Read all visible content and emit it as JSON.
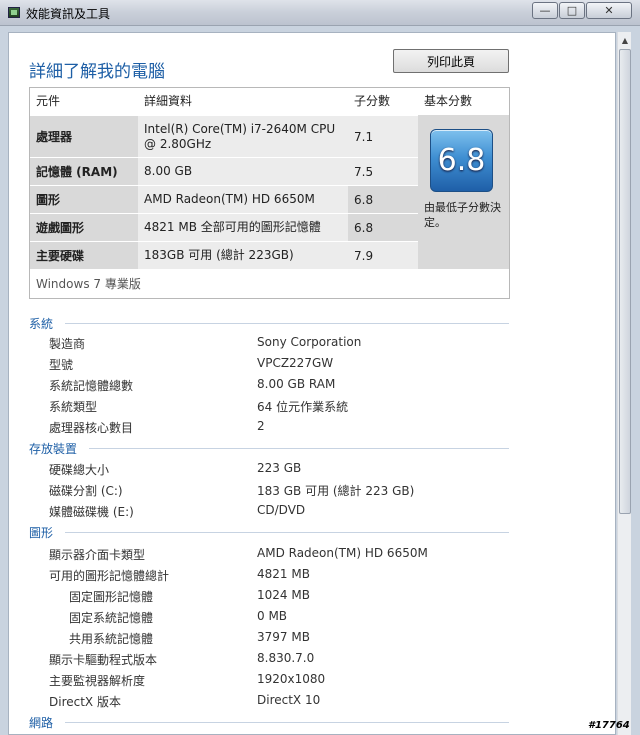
{
  "window": {
    "title": "效能資訊及工具",
    "min": "—",
    "max": "□",
    "close": "✕"
  },
  "page": {
    "title": "詳細了解我的電腦",
    "print_button": "列印此頁"
  },
  "score_table": {
    "headers": {
      "component": "元件",
      "details": "詳細資料",
      "subscore": "子分數",
      "base": "基本分數"
    },
    "rows": [
      {
        "name": "處理器",
        "detail": "Intel(R) Core(TM) i7-2640M CPU @ 2.80GHz",
        "subscore": "7.1"
      },
      {
        "name": "記憶體 (RAM)",
        "detail": "8.00 GB",
        "subscore": "7.5"
      },
      {
        "name": "圖形",
        "detail": "AMD Radeon(TM) HD 6650M",
        "subscore": "6.8"
      },
      {
        "name": "遊戲圖形",
        "detail": "4821 MB 全部可用的圖形記憶體",
        "subscore": "6.8"
      },
      {
        "name": "主要硬碟",
        "detail": "183GB 可用 (總計 223GB)",
        "subscore": "7.9"
      }
    ],
    "base_score": "6.8",
    "base_note": "由最低子分數決定。",
    "os": "Windows 7 專業版"
  },
  "sections": {
    "system": {
      "title": "系統",
      "items": [
        {
          "label": "製造商",
          "value": "Sony Corporation"
        },
        {
          "label": "型號",
          "value": "VPCZ227GW"
        },
        {
          "label": "系統記憶體總數",
          "value": "8.00 GB RAM"
        },
        {
          "label": "系統類型",
          "value": "64 位元作業系統"
        },
        {
          "label": "處理器核心數目",
          "value": "2"
        }
      ]
    },
    "storage": {
      "title": "存放裝置",
      "items": [
        {
          "label": "硬碟總大小",
          "value": "223 GB"
        },
        {
          "label": "磁碟分割 (C:)",
          "value": "183 GB 可用 (總計 223 GB)"
        },
        {
          "label": "媒體磁碟機 (E:)",
          "value": "CD/DVD"
        }
      ]
    },
    "graphics": {
      "title": "圖形",
      "items": [
        {
          "label": "顯示器介面卡類型",
          "value": "AMD Radeon(TM) HD 6650M"
        },
        {
          "label": "可用的圖形記憶體總計",
          "value": "4821 MB"
        },
        {
          "label": "固定圖形記憶體",
          "value": "1024 MB"
        },
        {
          "label": "固定系統記憶體",
          "value": "0 MB"
        },
        {
          "label": "共用系統記憶體",
          "value": "3797 MB"
        },
        {
          "label": "顯示卡驅動程式版本",
          "value": "8.830.7.0"
        },
        {
          "label": "主要監視器解析度",
          "value": "1920x1080"
        },
        {
          "label": "DirectX 版本",
          "value": "DirectX 10"
        }
      ]
    },
    "network": {
      "title": "網路"
    }
  },
  "watermark": "#17764"
}
